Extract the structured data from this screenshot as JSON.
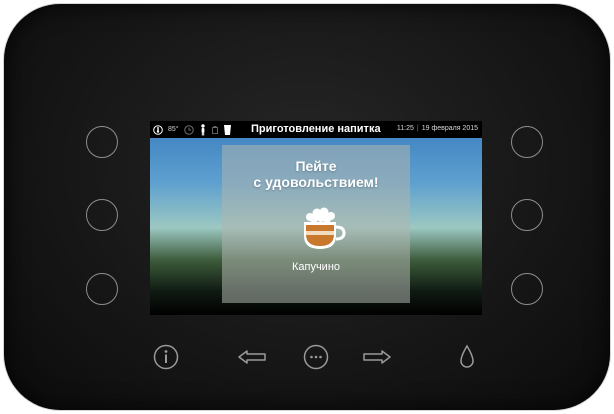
{
  "status_bar": {
    "temperature": "85°",
    "title": "Приготовление напитка",
    "time": "11:25",
    "date": "19 февраля 2015"
  },
  "message": {
    "line1": "Пейте",
    "line2": "с удовольствием!"
  },
  "drink": {
    "name": "Капучино",
    "icon": "cappuccino-cup-icon"
  },
  "colors": {
    "panel": "#171717",
    "button_outline": "#8e8e8e",
    "cup_coffee": "#c8792d",
    "cup_milk": "#f1dcc0"
  },
  "controls": {
    "left_buttons": 3,
    "right_buttons": 3,
    "bottom_icons": [
      "info-icon",
      "arrow-left-icon",
      "menu-dots-icon",
      "arrow-right-icon",
      "water-drop-icon"
    ]
  }
}
